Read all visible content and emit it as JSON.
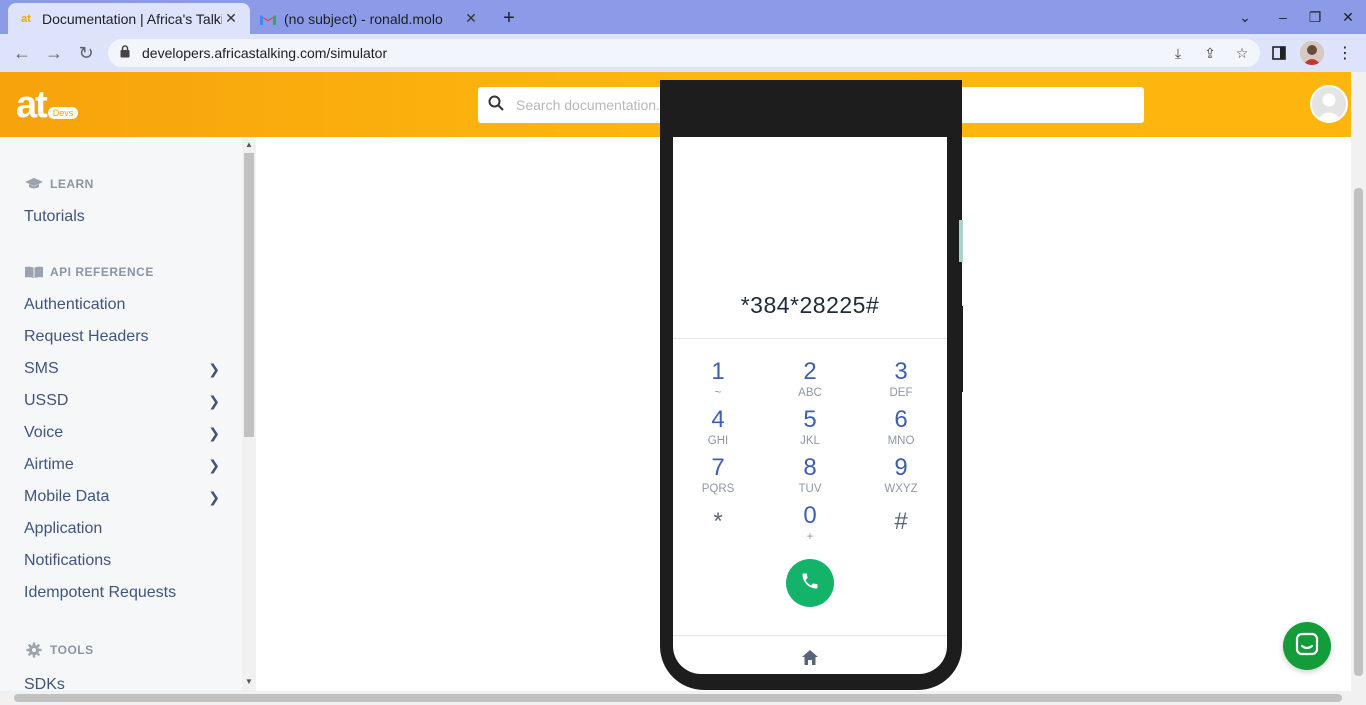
{
  "browser": {
    "tabs": [
      {
        "title": "Documentation | Africa's Talking",
        "active": true,
        "favicon": "africastalking-favicon"
      },
      {
        "title": "(no subject) - ronald.molo",
        "active": false,
        "favicon": "gmail-favicon"
      }
    ],
    "url": "developers.africastalking.com/simulator"
  },
  "header": {
    "logo_text": "at",
    "logo_badge": "Devs",
    "search_placeholder": "Search documentation..."
  },
  "sidebar": {
    "sections": [
      {
        "heading": "LEARN",
        "icon": "graduation-cap-icon",
        "items": [
          {
            "label": "Tutorials",
            "expandable": false
          }
        ]
      },
      {
        "heading": "API REFERENCE",
        "icon": "book-icon",
        "items": [
          {
            "label": "Authentication",
            "expandable": false
          },
          {
            "label": "Request Headers",
            "expandable": false
          },
          {
            "label": "SMS",
            "expandable": true
          },
          {
            "label": "USSD",
            "expandable": true
          },
          {
            "label": "Voice",
            "expandable": true
          },
          {
            "label": "Airtime",
            "expandable": true
          },
          {
            "label": "Mobile Data",
            "expandable": true
          },
          {
            "label": "Application",
            "expandable": false
          },
          {
            "label": "Notifications",
            "expandable": false
          },
          {
            "label": "Idempotent Requests",
            "expandable": false
          }
        ]
      },
      {
        "heading": "TOOLS",
        "icon": "gear-icon",
        "items": [
          {
            "label": "SDKs",
            "expandable": false
          }
        ]
      }
    ]
  },
  "simulator": {
    "dialed_number": "*384*28225#",
    "keys": [
      {
        "digit": "1",
        "letters": "~"
      },
      {
        "digit": "2",
        "letters": "ABC"
      },
      {
        "digit": "3",
        "letters": "DEF"
      },
      {
        "digit": "4",
        "letters": "GHI"
      },
      {
        "digit": "5",
        "letters": "JKL"
      },
      {
        "digit": "6",
        "letters": "MNO"
      },
      {
        "digit": "7",
        "letters": "PQRS"
      },
      {
        "digit": "8",
        "letters": "TUV"
      },
      {
        "digit": "9",
        "letters": "WXYZ"
      },
      {
        "digit": "*",
        "letters": ""
      },
      {
        "digit": "0",
        "letters": "+"
      },
      {
        "digit": "#",
        "letters": ""
      }
    ]
  },
  "colors": {
    "header_orange": "#fdb70e",
    "link_text": "#41557a",
    "key_blue": "#3e5fb0",
    "call_green": "#14b36a",
    "chat_green": "#149b3a"
  }
}
